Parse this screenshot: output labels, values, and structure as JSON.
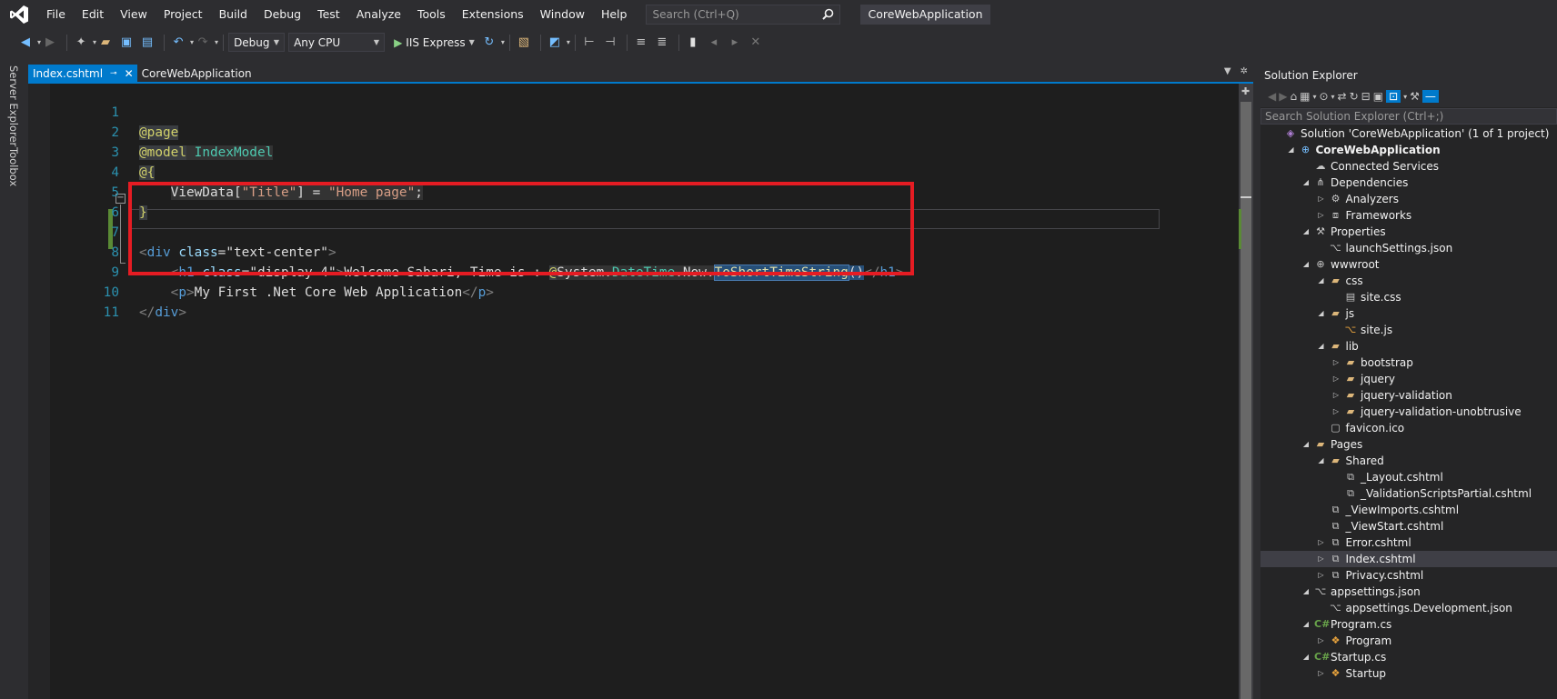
{
  "menu": {
    "items": [
      "File",
      "Edit",
      "View",
      "Project",
      "Build",
      "Debug",
      "Test",
      "Analyze",
      "Tools",
      "Extensions",
      "Window",
      "Help"
    ],
    "search_placeholder": "Search (Ctrl+Q)",
    "project_title": "CoreWebApplication"
  },
  "toolbar": {
    "config": "Debug",
    "platform": "Any CPU",
    "run_label": "IIS Express"
  },
  "left_tabs": [
    "Server Explorer",
    "Toolbox"
  ],
  "editor": {
    "tab_label": "Index.cshtml",
    "breadcrumb": "CoreWebApplication",
    "line_numbers": [
      "1",
      "2",
      "3",
      "4",
      "5",
      "6",
      "7",
      "8",
      "9",
      "10",
      "11"
    ],
    "code": {
      "l1_page": "@page",
      "l2_model": "@model",
      "l2_type": "IndexModel",
      "l3_open": "@{",
      "l4_viewdata": "ViewData[",
      "l4_key": "\"Title\"",
      "l4_eq": "] = ",
      "l4_val": "\"Home page\"",
      "l4_semi": ";",
      "l5_close": "}",
      "l7_lt": "<",
      "l7_tag": "div",
      "l7_attr": "class",
      "l7_eq": "=",
      "l7_val": "\"text-center\"",
      "l7_gt": ">",
      "l8_lt": "<",
      "l8_tag": "h1",
      "l8_attr": "class",
      "l8_eq": "=",
      "l8_val": "\"display-4\"",
      "l8_gt": ">",
      "l8_text": "Welcome Sabari, Time is : ",
      "l8_at": "@",
      "l8_system": "System",
      "l8_dot1": ".",
      "l8_datetime": "DateTime",
      "l8_dot2": ".",
      "l8_now": "Now",
      "l8_dot3": ".",
      "l8_method": "ToShortTimeString",
      "l8_parens": "()",
      "l8_close_lt": "</",
      "l8_close_tag": "h1",
      "l8_close_gt": ">",
      "l9_lt": "<",
      "l9_tag": "p",
      "l9_gt": ">",
      "l9_text": "My First .Net Core Web Application",
      "l9_close_lt": "</",
      "l9_close_tag": "p",
      "l9_close_gt": ">",
      "l10_lt": "</",
      "l10_tag": "div",
      "l10_gt": ">"
    }
  },
  "solution_explorer": {
    "title": "Solution Explorer",
    "search_placeholder": "Search Solution Explorer (Ctrl+;)",
    "nodes": [
      {
        "label": "Solution 'CoreWebApplication' (1 of 1 project)",
        "icon": "solution-icon"
      },
      {
        "label": "CoreWebApplication",
        "icon": "web-project-icon"
      },
      {
        "label": "Connected Services",
        "icon": "connected-services-icon"
      },
      {
        "label": "Dependencies",
        "icon": "dependencies-icon"
      },
      {
        "label": "Analyzers",
        "icon": "analyzers-icon"
      },
      {
        "label": "Frameworks",
        "icon": "frameworks-icon"
      },
      {
        "label": "Properties",
        "icon": "wrench-icon"
      },
      {
        "label": "launchSettings.json",
        "icon": "json-file-icon"
      },
      {
        "label": "wwwroot",
        "icon": "globe-icon"
      },
      {
        "label": "css",
        "icon": "folder-icon"
      },
      {
        "label": "site.css",
        "icon": "css-file-icon"
      },
      {
        "label": "js",
        "icon": "folder-icon"
      },
      {
        "label": "site.js",
        "icon": "js-file-icon"
      },
      {
        "label": "lib",
        "icon": "folder-icon"
      },
      {
        "label": "bootstrap",
        "icon": "folder-icon"
      },
      {
        "label": "jquery",
        "icon": "folder-icon"
      },
      {
        "label": "jquery-validation",
        "icon": "folder-icon"
      },
      {
        "label": "jquery-validation-unobtrusive",
        "icon": "folder-icon"
      },
      {
        "label": "favicon.ico",
        "icon": "image-file-icon"
      },
      {
        "label": "Pages",
        "icon": "folder-icon"
      },
      {
        "label": "Shared",
        "icon": "folder-icon"
      },
      {
        "label": "_Layout.cshtml",
        "icon": "razor-file-icon"
      },
      {
        "label": "_ValidationScriptsPartial.cshtml",
        "icon": "razor-file-icon"
      },
      {
        "label": "_ViewImports.cshtml",
        "icon": "razor-file-icon"
      },
      {
        "label": "_ViewStart.cshtml",
        "icon": "razor-file-icon"
      },
      {
        "label": "Error.cshtml",
        "icon": "razor-file-icon"
      },
      {
        "label": "Index.cshtml",
        "icon": "razor-file-icon"
      },
      {
        "label": "Privacy.cshtml",
        "icon": "razor-file-icon"
      },
      {
        "label": "appsettings.json",
        "icon": "json-file-icon"
      },
      {
        "label": "appsettings.Development.json",
        "icon": "json-file-icon"
      },
      {
        "label": "Program.cs",
        "icon": "csharp-file-icon"
      },
      {
        "label": "Program",
        "icon": "class-icon"
      },
      {
        "label": "Startup.cs",
        "icon": "csharp-file-icon"
      },
      {
        "label": "Startup",
        "icon": "class-icon"
      }
    ]
  }
}
